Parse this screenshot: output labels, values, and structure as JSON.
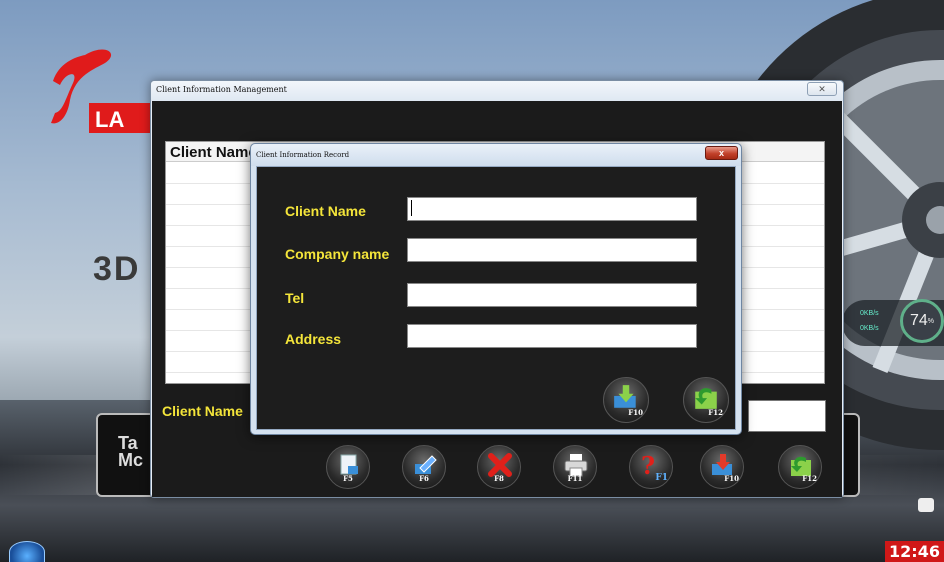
{
  "desktop": {
    "brand_partial": "LA",
    "brand_3d_partial": "3D",
    "left_panel_text": "Ta\nMc",
    "gauge_value": "74",
    "gauge_unit": "%",
    "gauge_line1": "0KB/s",
    "gauge_line2": "0KB/s",
    "clock": "12:46"
  },
  "main_window": {
    "title": "Client Information Management",
    "close_label": "✕",
    "grid": {
      "column_header": "Client Name",
      "rows": [
        "",
        "",
        "",
        "",
        "",
        "",
        "",
        "",
        "",
        "",
        ""
      ]
    },
    "filter_label": "Client Name",
    "filter_value": "",
    "toolbar": [
      {
        "key": "F5",
        "icon": "new-record-icon"
      },
      {
        "key": "F6",
        "icon": "edit-icon"
      },
      {
        "key": "F8",
        "icon": "delete-icon"
      },
      {
        "key": "F11",
        "icon": "print-icon"
      },
      {
        "key": "F1",
        "icon": "help-icon"
      },
      {
        "key": "F10",
        "icon": "save-icon"
      },
      {
        "key": "F12",
        "icon": "return-icon"
      }
    ]
  },
  "dialog": {
    "title": "Client Information Record",
    "close_label": "x",
    "fields": [
      {
        "label": "Client Name",
        "value": ""
      },
      {
        "label": "Company name",
        "value": ""
      },
      {
        "label": "Tel",
        "value": ""
      },
      {
        "label": "Address",
        "value": ""
      }
    ],
    "buttons": [
      {
        "key": "F10",
        "icon": "save-icon"
      },
      {
        "key": "F12",
        "icon": "return-icon"
      }
    ]
  },
  "colors": {
    "label_yellow": "#f4e53a",
    "panel_dark": "#1b1b1b",
    "clock_red": "#d01818",
    "title_bar": "#dfe8f2"
  }
}
